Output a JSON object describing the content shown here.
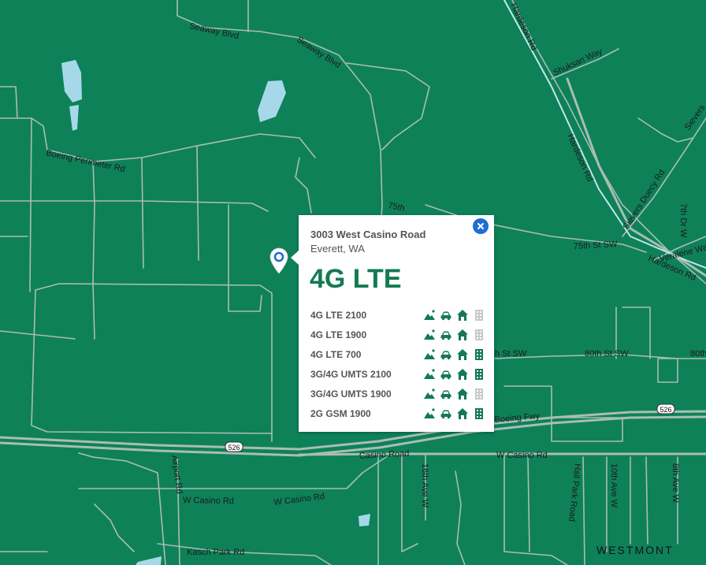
{
  "colors": {
    "land": "#0e8159",
    "road": "#a9bdb4",
    "water": "#a6d8ea",
    "coverage_on": "#137a52",
    "coverage_off": "#c9c9c9",
    "close_button": "#1f6ed4"
  },
  "map": {
    "road_labels": [
      "Seaway Blvd",
      "Seaway Blvd",
      "Boeing Perimeter Rd",
      "Hardeson Rd",
      "Shuksan Way",
      "Hardeson Rd",
      "Sievers Duecy Rd",
      "75th St SW",
      "Veralene Way",
      "7th Dr W",
      "Hardeson Rd",
      "Sievers",
      "75th",
      "80th St SW",
      "80th",
      "h St SW",
      "Boeing Fwy",
      "Casino Road",
      "W Casino Rd",
      "W Casino Rd",
      "W Casino Rd",
      "Airport Rd",
      "Kasch Park Rd",
      "16th Ave W",
      "Hall Park Road",
      "10th Ave W",
      "8th Ave W"
    ],
    "place_label": "WESTMONT",
    "highway_shields": [
      "526",
      "526"
    ]
  },
  "marker": {
    "icon": "location-pin-icon"
  },
  "popup": {
    "address": "3003 West Casino Road",
    "city": "Everett, WA",
    "technology": "4G LTE",
    "close_icon": "close-icon",
    "coverage_icons": [
      "outdoor-icon",
      "in-vehicle-icon",
      "in-home-icon",
      "in-building-icon"
    ],
    "bands": [
      {
        "label": "4G LTE 2100",
        "outdoor": true,
        "vehicle": true,
        "home": true,
        "building": false
      },
      {
        "label": "4G LTE 1900",
        "outdoor": true,
        "vehicle": true,
        "home": true,
        "building": false
      },
      {
        "label": "4G LTE 700",
        "outdoor": true,
        "vehicle": true,
        "home": true,
        "building": true
      },
      {
        "label": "3G/4G UMTS 2100",
        "outdoor": true,
        "vehicle": true,
        "home": true,
        "building": true
      },
      {
        "label": "3G/4G UMTS 1900",
        "outdoor": true,
        "vehicle": true,
        "home": true,
        "building": false
      },
      {
        "label": "2G GSM 1900",
        "outdoor": true,
        "vehicle": true,
        "home": true,
        "building": true
      }
    ]
  }
}
